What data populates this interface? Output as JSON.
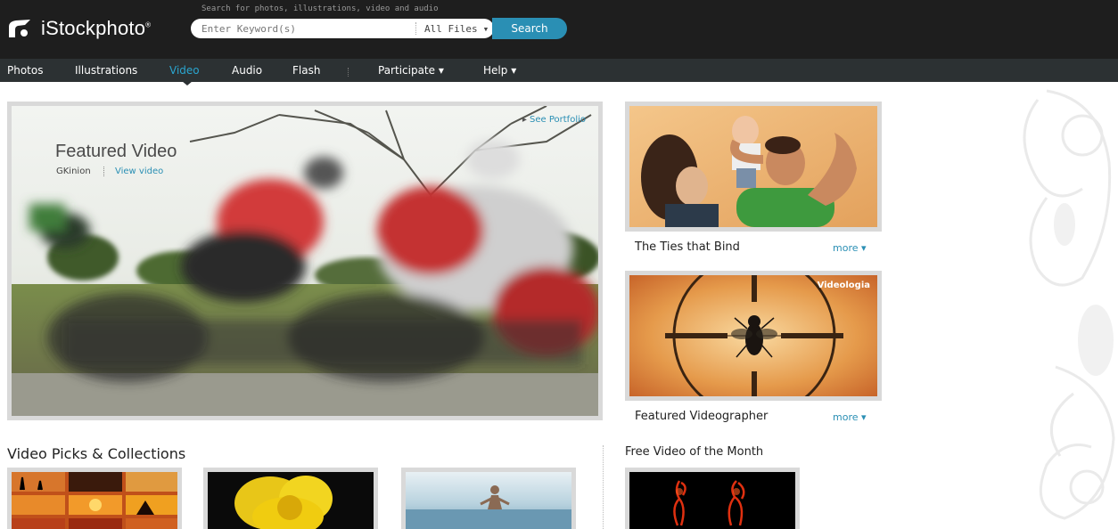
{
  "brand": {
    "name": "iStockphoto",
    "reg": "®"
  },
  "search": {
    "hint": "Search for photos, illustrations, video and audio",
    "placeholder": "Enter Keyword(s)",
    "file_type": "All Files",
    "button": "Search"
  },
  "nav": {
    "items": [
      {
        "label": "Photos"
      },
      {
        "label": "Illustrations"
      },
      {
        "label": "Video",
        "active": true
      },
      {
        "label": "Audio"
      },
      {
        "label": "Flash"
      },
      {
        "label": "Participate"
      },
      {
        "label": "Help"
      }
    ],
    "caret_glyph": "▾"
  },
  "featured": {
    "title": "Featured Video",
    "author": "GKinion",
    "view_link": "View video",
    "portfolio_link": "See Portfolio",
    "portfolio_glyph": "▸"
  },
  "side_cards": [
    {
      "caption": "The Ties that Bind",
      "more": "more"
    },
    {
      "caption": "Featured Videographer",
      "more": "more",
      "badge": "Videologia"
    }
  ],
  "sections": {
    "picks_heading": "Video Picks & Collections",
    "free_heading": "Free Video of the Month"
  },
  "colors": {
    "header_bg": "#1e1e1e",
    "nav_bg": "#2c3133",
    "accent": "#2a8fb4",
    "active_nav": "#2aa5cf",
    "frame": "#d9d9d9"
  },
  "icons": {
    "logo": "camera-shutter-icon",
    "dropdown": "chevron-down-icon",
    "arrow": "play-arrow-icon"
  }
}
